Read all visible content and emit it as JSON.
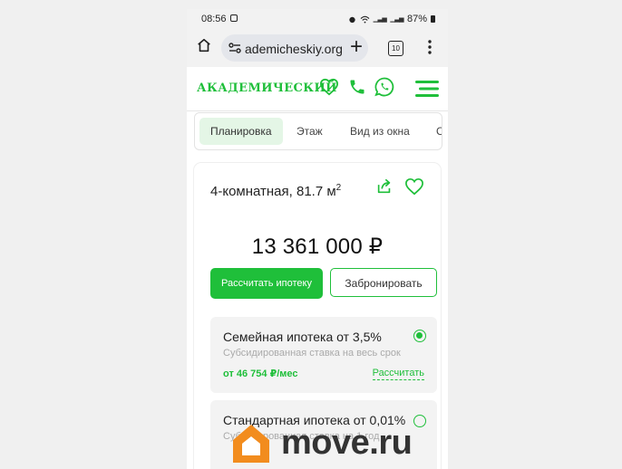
{
  "status_bar": {
    "time": "08:56",
    "battery": "87%"
  },
  "browser": {
    "url": "ademicheskiy.org",
    "tabs_count": "10"
  },
  "site": {
    "logo": "АКАДЕМИЧЕСКИЙ",
    "brand_color": "#1fbf3a"
  },
  "tabs": [
    {
      "label": "Планировка",
      "active": true
    },
    {
      "label": "Этаж",
      "active": false
    },
    {
      "label": "Вид из окна",
      "active": false
    },
    {
      "label": "С",
      "active": false
    }
  ],
  "apartment": {
    "title": "4-комнатная, 81.7 м",
    "title_sup": "2",
    "price": "13 361 000 ₽",
    "btn_mortgage": "Рассчитать ипотеку",
    "btn_book": "Забронировать"
  },
  "offers": [
    {
      "title": "Семейная ипотека от 3,5%",
      "subtitle": "Субсидированная ставка на весь срок",
      "payment": "от 46 754 ₽/мес",
      "calc_link": "Рассчитать",
      "selected": true
    },
    {
      "title": "Стандартная ипотека от 0,01%",
      "subtitle": "Субсидированная ставка на 1 год",
      "selected": false
    }
  ],
  "watermark": {
    "text": "move.ru"
  }
}
